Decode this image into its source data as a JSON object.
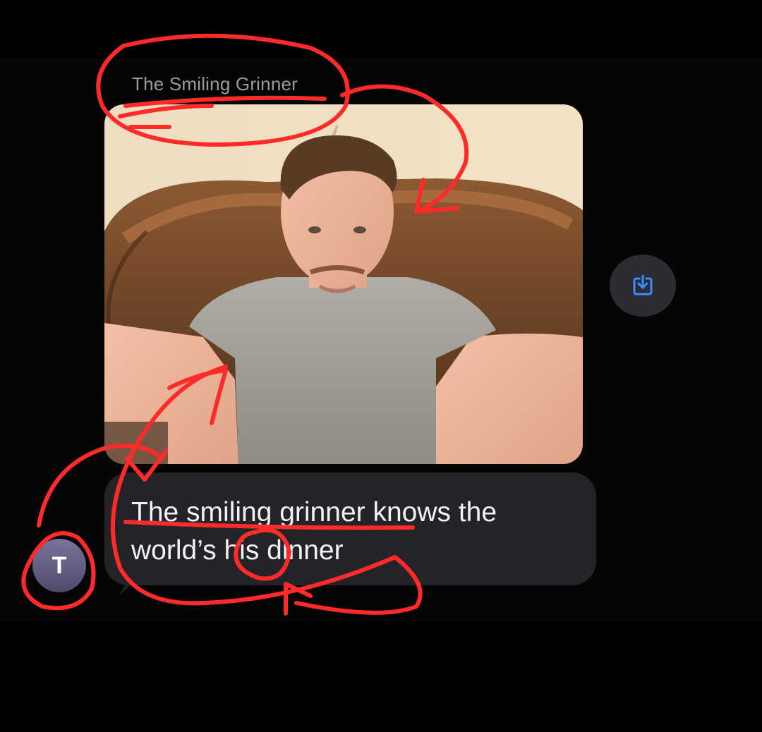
{
  "conversation": {
    "sender_name": "The Smiling Grinner",
    "avatar_initial": "T",
    "message_text": "The smiling grinner knows the\nworld’s his dinner"
  },
  "photo": {
    "subject": "selfie of a smiling man in a grey t-shirt on a brown leather couch"
  },
  "save_button": {
    "icon": "download-icon"
  },
  "colors": {
    "background": "#000000",
    "bubble": "#242428",
    "accent_blue": "#3b8cff",
    "annotation_red": "#ff2a2a"
  }
}
